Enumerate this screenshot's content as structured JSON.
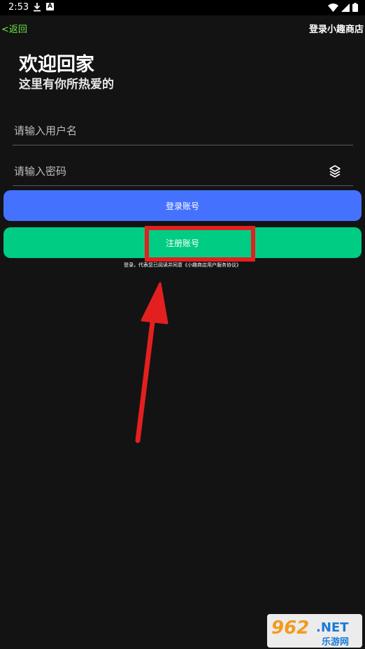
{
  "status_bar": {
    "time": "2:53"
  },
  "header": {
    "back_label": "<返回",
    "title": "登录小趣商店"
  },
  "welcome": {
    "title": "欢迎回家",
    "subtitle": "这里有你所热爱的"
  },
  "form": {
    "username_placeholder": "请输入用户名",
    "password_placeholder": "请输入密码",
    "login_label": "登录账号",
    "register_label": "注册账号",
    "agreement_text": "登录，代表您已阅读并同意《小趣商店用户服务协议》"
  },
  "watermark": {
    "brand_number": "962",
    "brand_suffix": ".NET",
    "brand_cn": "乐游网"
  },
  "colors": {
    "background": "#131313",
    "login_button": "#4472ff",
    "register_button": "#00cc83",
    "back_link": "#6fe84a",
    "annotation": "#e3201f"
  }
}
